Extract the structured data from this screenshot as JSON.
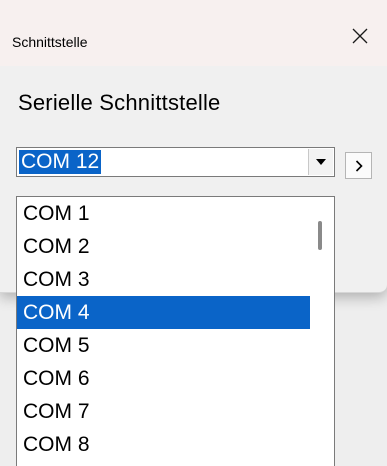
{
  "window": {
    "title": "Schnittstelle",
    "close_icon": "close-icon"
  },
  "main": {
    "heading": "Serielle Schnittstelle",
    "combo": {
      "selected_value": "COM 12",
      "arrow_icon": "dropdown-arrow-icon"
    },
    "next_button": {
      "icon": "chevron-right-icon",
      "label": ">"
    }
  },
  "dropdown": {
    "items": [
      "COM 1",
      "COM 2",
      "COM 3",
      "COM 4",
      "COM 5",
      "COM 6",
      "COM 7",
      "COM 8"
    ],
    "highlighted_item": "COM 4"
  },
  "colors": {
    "selection": "#0a64c8",
    "titlebar": "#f7f0ef",
    "dialog_bg": "#f0f0f0"
  }
}
